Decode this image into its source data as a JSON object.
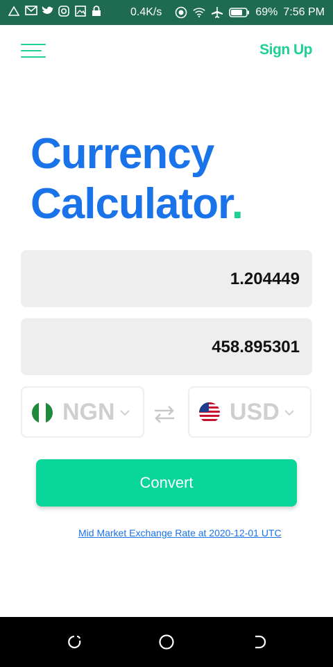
{
  "status_bar": {
    "speed": "0.4K/s",
    "battery": "69%",
    "time": "7:56 PM",
    "icons": [
      "warning-icon",
      "gmail-icon",
      "twitter-icon",
      "instagram-icon",
      "gallery-icon",
      "lock-icon",
      "vpn-icon",
      "wifi-icon",
      "airplane-icon",
      "battery-icon"
    ]
  },
  "header": {
    "signup_label": "Sign Up"
  },
  "title": {
    "line1": "Currency",
    "line2": "Calculator",
    "dot": "."
  },
  "from_amount": "1.204449",
  "to_amount": "458.895301",
  "from_currency": {
    "code": "NGN",
    "flag": "nigeria-flag"
  },
  "to_currency": {
    "code": "USD",
    "flag": "us-flag"
  },
  "convert_label": "Convert",
  "rate_link": "Mid Market Exchange Rate at 2020-12-01 UTC",
  "colors": {
    "accent_green": "#1fcf93",
    "button_green": "#0bd69a",
    "brand_blue": "#1a73e8",
    "status_bar": "#1e6b52"
  }
}
